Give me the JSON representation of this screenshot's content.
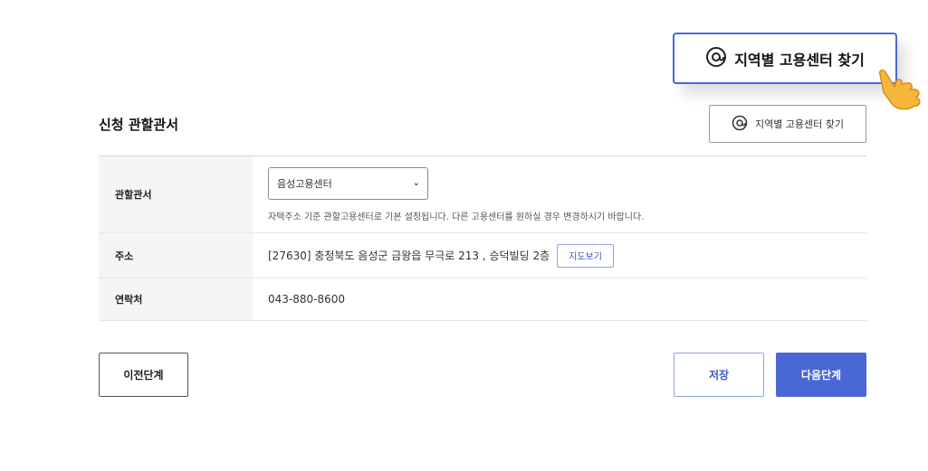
{
  "callout": {
    "label": "지역별 고용센터 찾기"
  },
  "section": {
    "title": "신청 관할관서",
    "find_button_label": "지역별 고용센터 찾기"
  },
  "rows": [
    {
      "label": "관할관서",
      "select_value": "음성고용센터",
      "hint": "자택주소 기준 관할고용센터로 기본 설정됩니다. 다른 고용센터를 원하실 경우 변경하시기 바랍니다."
    },
    {
      "label": "주소",
      "value": "[27630] 충청북도 음성군 금왕읍 무극로 213 , 승덕빌딩 2층",
      "map_button_label": "지도보기"
    },
    {
      "label": "연락처",
      "value": "043-880-8600"
    }
  ],
  "footer": {
    "prev_label": "이전단계",
    "save_label": "저장",
    "next_label": "다음단계"
  },
  "colors": {
    "accent": "#4a67d6",
    "accent_text": "#3c59c8"
  }
}
